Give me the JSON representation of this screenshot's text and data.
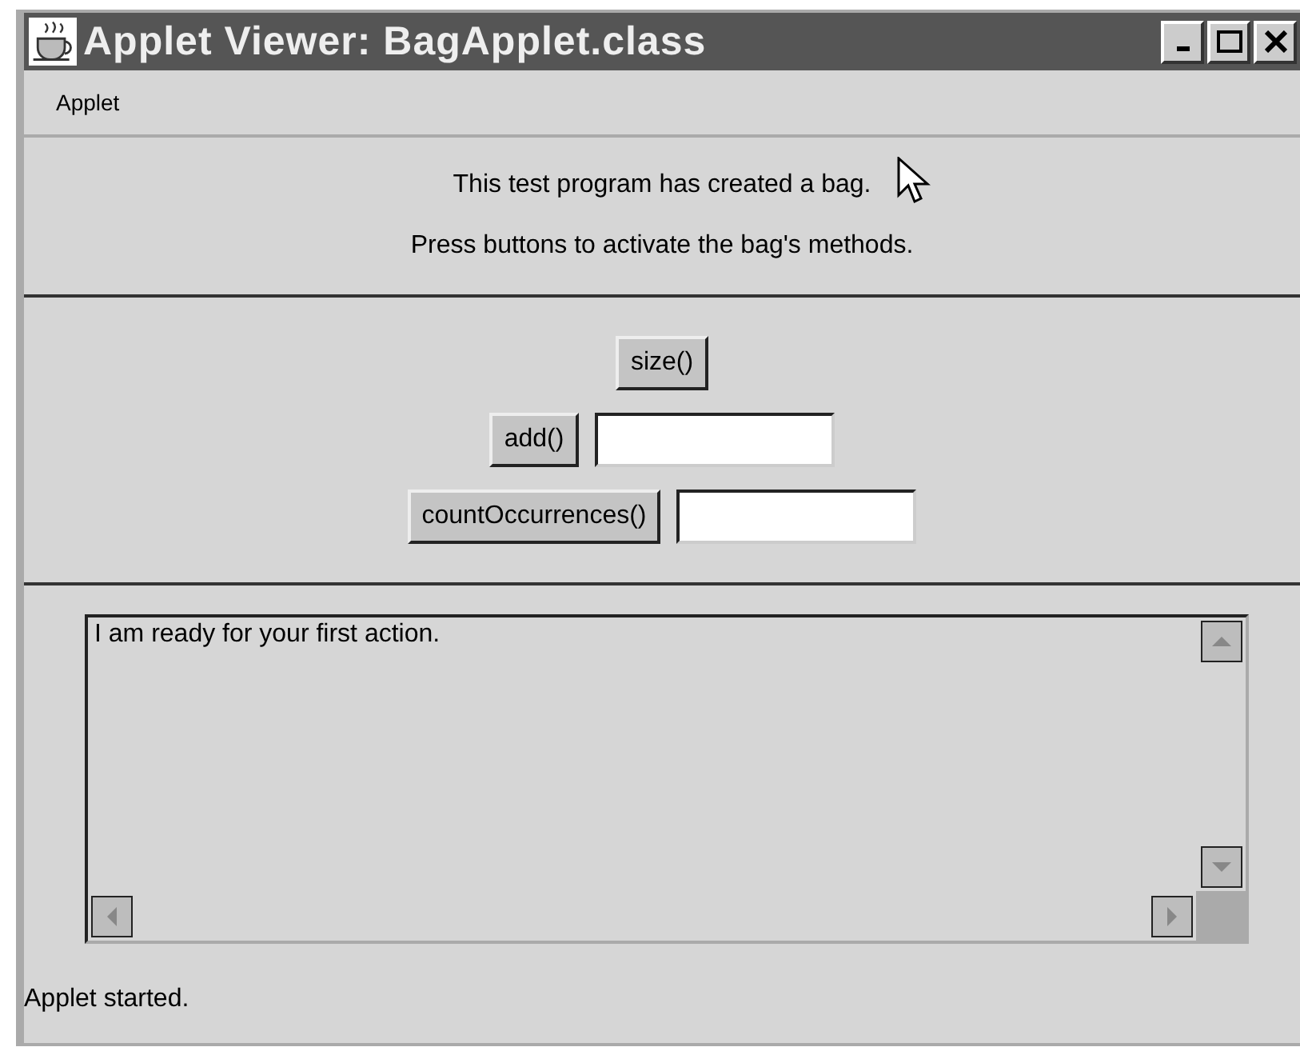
{
  "window": {
    "title": "Applet Viewer: BagApplet.class"
  },
  "menu": [
    "Applet"
  ],
  "messages": [
    "This test program has created a bag.",
    "Press buttons to activate the bag's methods."
  ],
  "controls": [
    {
      "kind": "button",
      "label": "size()"
    },
    {
      "kind": "button_field",
      "label": "add()"
    },
    {
      "kind": "button_field",
      "label": "countOccurrences()"
    }
  ],
  "output": {
    "text": "I am ready for your first action."
  },
  "status_bar": "Applet started."
}
